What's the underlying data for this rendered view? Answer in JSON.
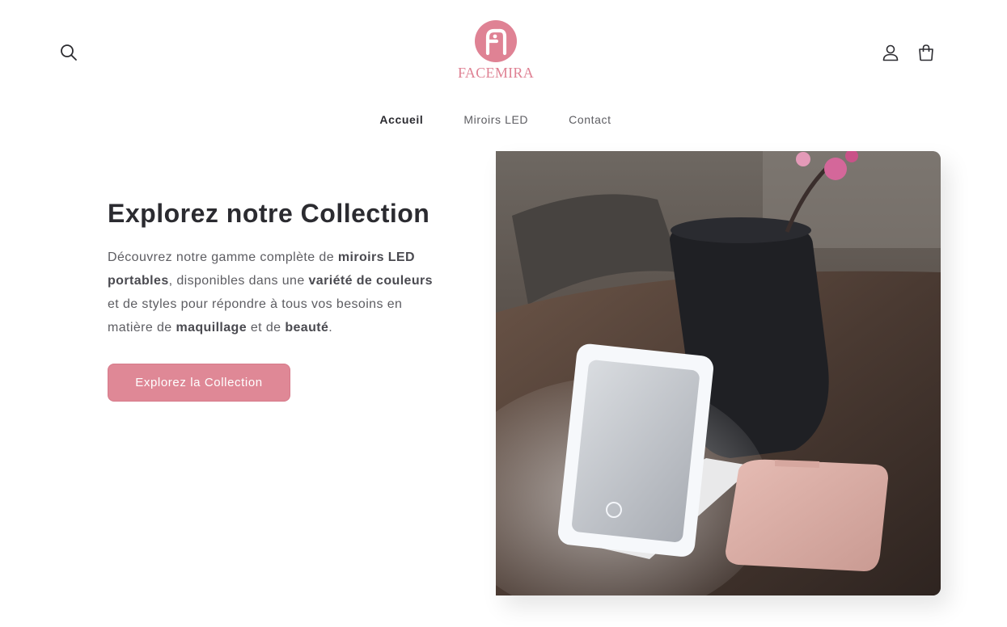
{
  "header": {
    "brand": "FACEMIRA",
    "icons": {
      "search": "search-icon",
      "account": "user-icon",
      "cart": "cart-icon"
    }
  },
  "nav": {
    "items": [
      {
        "label": "Accueil",
        "active": true
      },
      {
        "label": "Miroirs LED",
        "active": false
      },
      {
        "label": "Contact",
        "active": false
      }
    ]
  },
  "hero": {
    "title": "Explorez notre Collection",
    "description": [
      {
        "text": "Découvrez notre gamme complète de ",
        "bold": false
      },
      {
        "text": "miroirs LED portables",
        "bold": true
      },
      {
        "text": ", disponibles dans une ",
        "bold": false
      },
      {
        "text": "variété de couleurs",
        "bold": true
      },
      {
        "text": " et de styles pour répondre à tous vos besoins en matière de ",
        "bold": false
      },
      {
        "text": "maquillage",
        "bold": true
      },
      {
        "text": " et de ",
        "bold": false
      },
      {
        "text": "beauté",
        "bold": true
      },
      {
        "text": ".",
        "bold": false
      }
    ],
    "cta_label": "Explorez la Collection"
  },
  "colors": {
    "accent": "#df8896",
    "brand": "#df8294",
    "text": "#2b2b30",
    "muted": "#5d5d62"
  }
}
